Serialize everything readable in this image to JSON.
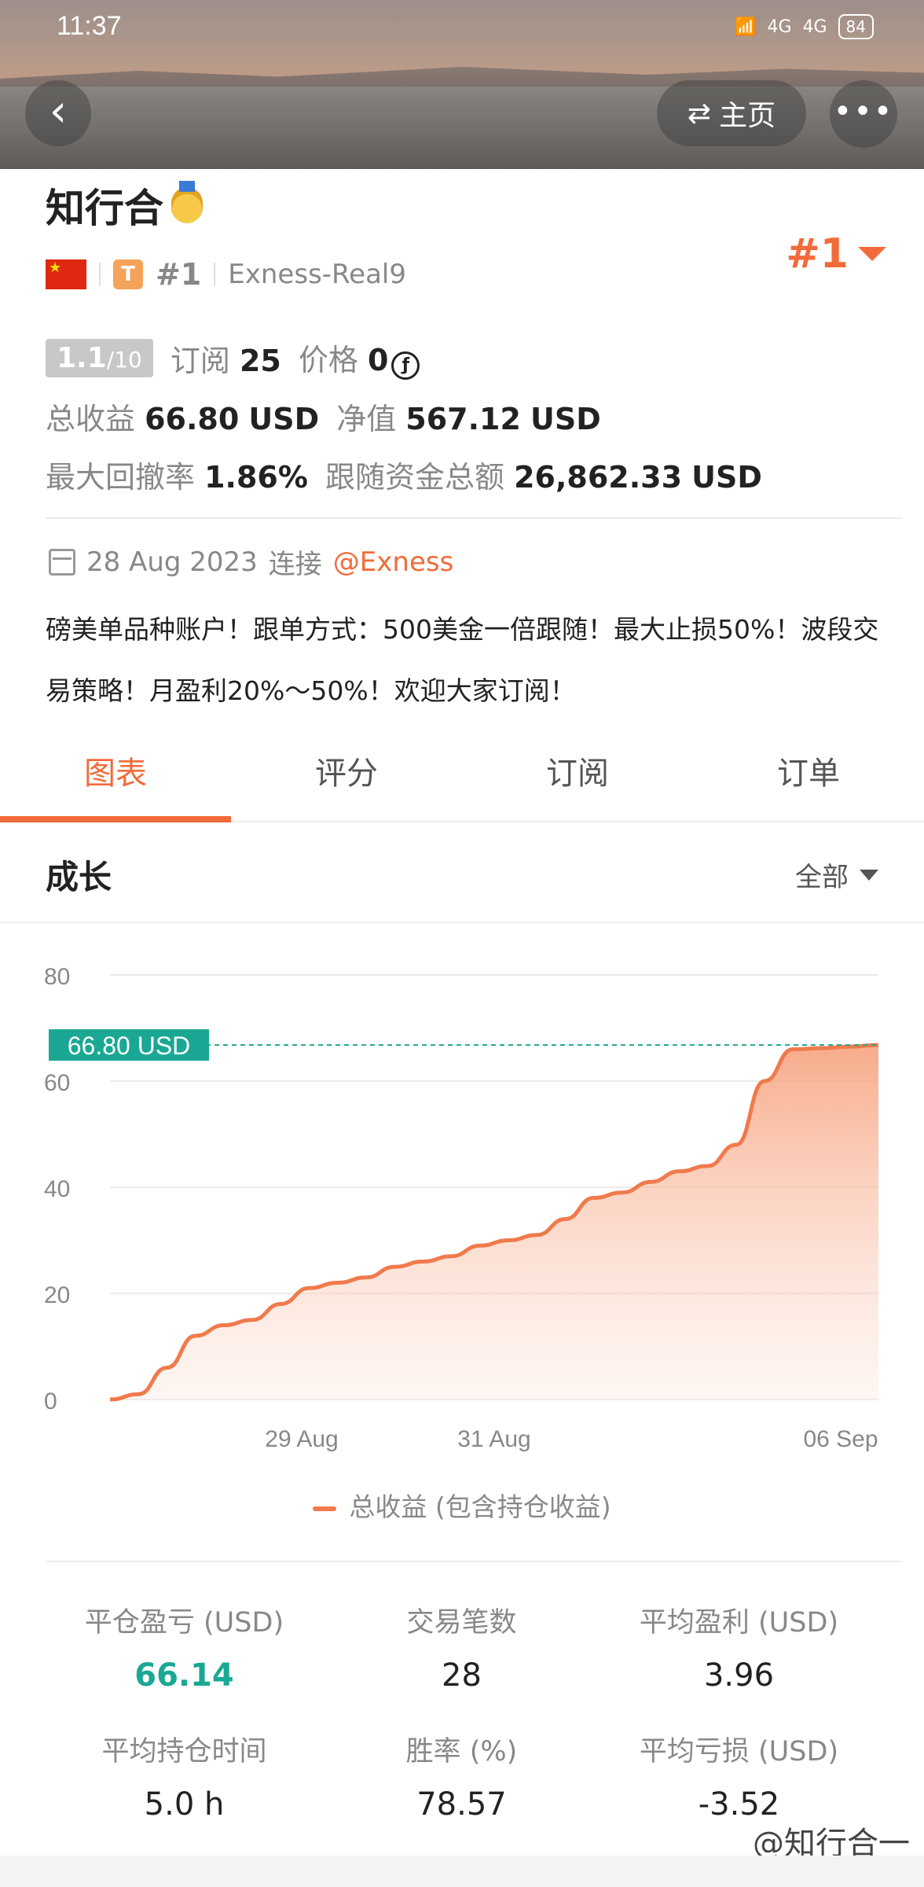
{
  "status": {
    "time": "11:37",
    "net1": "4G",
    "net2": "4G",
    "battery": "84"
  },
  "nav": {
    "back_label": "‹",
    "home_label": "主页",
    "more_label": "•••"
  },
  "profile": {
    "name": "知行合",
    "rank_small": "#1",
    "server": "Exness-Real9",
    "rank_big": "#1",
    "t_badge": "T"
  },
  "stats": {
    "score_main": "1.1",
    "score_max": "/10",
    "subscribe_label": "订阅",
    "subscribe_value": "25",
    "price_label": "价格",
    "price_value": "0",
    "total_profit_label": "总收益",
    "total_profit_value": "66.80",
    "total_profit_unit": "USD",
    "equity_label": "净值",
    "equity_value": "567.12",
    "equity_unit": "USD",
    "drawdown_label": "最大回撤率",
    "drawdown_value": "1.86%",
    "follow_label": "跟随资金总额",
    "follow_value": "26,862.33",
    "follow_unit": "USD"
  },
  "connect": {
    "date": "28 Aug 2023",
    "verb": "连接",
    "broker": "@Exness"
  },
  "description": "磅美单品种账户！跟单方式：500美金一倍跟随！最大止损50%！波段交易策略！月盈利20%～50%！欢迎大家订阅！",
  "tabs": [
    {
      "label": "图表",
      "active": true
    },
    {
      "label": "评分",
      "active": false
    },
    {
      "label": "订阅",
      "active": false
    },
    {
      "label": "订单",
      "active": false
    }
  ],
  "section": {
    "title": "成长",
    "filter": "全部"
  },
  "chart_data": {
    "type": "area",
    "title": "",
    "xlabel": "",
    "ylabel": "",
    "ylim": [
      0,
      80
    ],
    "yticks": [
      0,
      20,
      40,
      60,
      80
    ],
    "xticks": [
      "29 Aug",
      "31 Aug",
      "06 Sep"
    ],
    "current_label": "66.80 USD",
    "series": [
      {
        "name": "总收益 (包含持仓收益)",
        "color": "#f07a4c",
        "values": [
          0,
          1,
          6,
          12,
          14,
          15,
          18,
          21,
          22,
          23,
          25,
          26,
          27,
          29,
          30,
          31,
          34,
          38,
          39,
          41,
          43,
          44,
          48,
          60,
          66,
          66.2,
          66.5,
          66.8
        ]
      }
    ]
  },
  "metrics": [
    {
      "label": "平仓盈亏 (USD)",
      "value": "66.14",
      "green": true
    },
    {
      "label": "交易笔数",
      "value": "28",
      "green": false
    },
    {
      "label": "平均盈利 (USD)",
      "value": "3.96",
      "green": false
    },
    {
      "label": "平均持仓时间",
      "value": "5.0 h",
      "green": false
    },
    {
      "label": "胜率 (%)",
      "value": "78.57",
      "green": false
    },
    {
      "label": "平均亏损 (USD)",
      "value": "-3.52",
      "green": false
    }
  ],
  "watermark": "@知行合一"
}
